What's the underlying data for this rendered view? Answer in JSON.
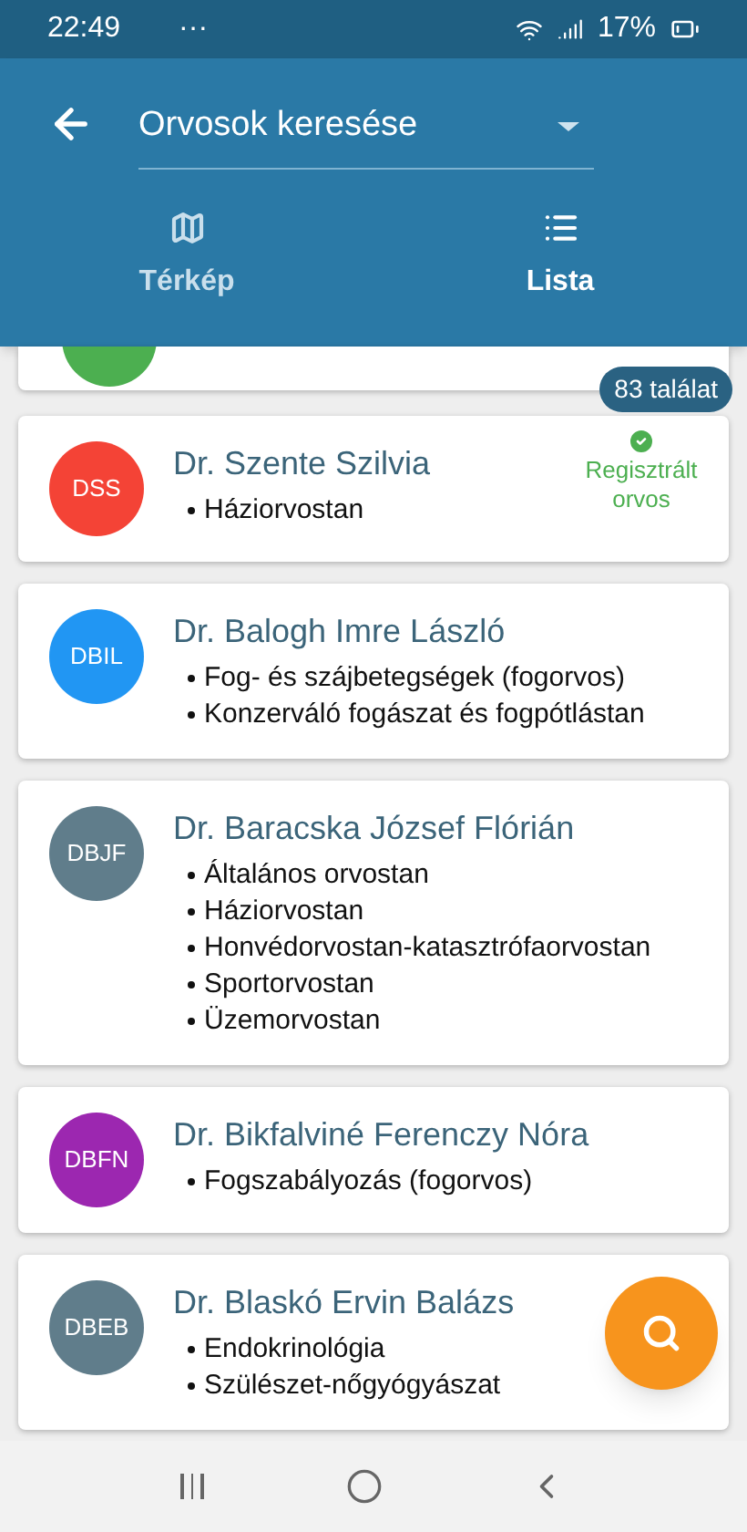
{
  "status_bar": {
    "time": "22:49",
    "dots": "···",
    "battery": "17%"
  },
  "header": {
    "title": "Orvosok keresése"
  },
  "tabs": [
    {
      "label": "Térkép",
      "kind": "map",
      "selected": false
    },
    {
      "label": "Lista",
      "kind": "list",
      "selected": true
    }
  ],
  "result_count": "83 találat",
  "doctors": [
    {
      "initials": "DSS",
      "color": "#f44336",
      "name": "Dr. Szente Szilvia",
      "specialties": [
        "Háziorvostan"
      ],
      "registered": true,
      "badge": "Regisztrált orvos"
    },
    {
      "initials": "DBIL",
      "color": "#2196f3",
      "name": "Dr. Balogh Imre László",
      "specialties": [
        "Fog- és szájbetegségek (fogorvos)",
        "Konzerváló fogászat és fogpótlástan"
      ],
      "registered": false
    },
    {
      "initials": "DBJF",
      "color": "#607d8b",
      "name": "Dr. Baracska József Flórián",
      "specialties": [
        "Általános orvostan",
        "Háziorvostan",
        "Honvédorvostan-katasztrófaorvostan",
        "Sportorvostan",
        "Üzemorvostan"
      ],
      "registered": false
    },
    {
      "initials": "DBFN",
      "color": "#9c27b0",
      "name": "Dr. Bikfalviné Ferenczy Nóra",
      "specialties": [
        "Fogszabályozás (fogorvos)"
      ],
      "registered": false
    },
    {
      "initials": "DBEB",
      "color": "#607d8b",
      "name": "Dr. Blaskó Ervin Balázs",
      "specialties": [
        "Endokrinológia",
        "Szülészet-nőgyógyászat"
      ],
      "registered": false
    }
  ]
}
